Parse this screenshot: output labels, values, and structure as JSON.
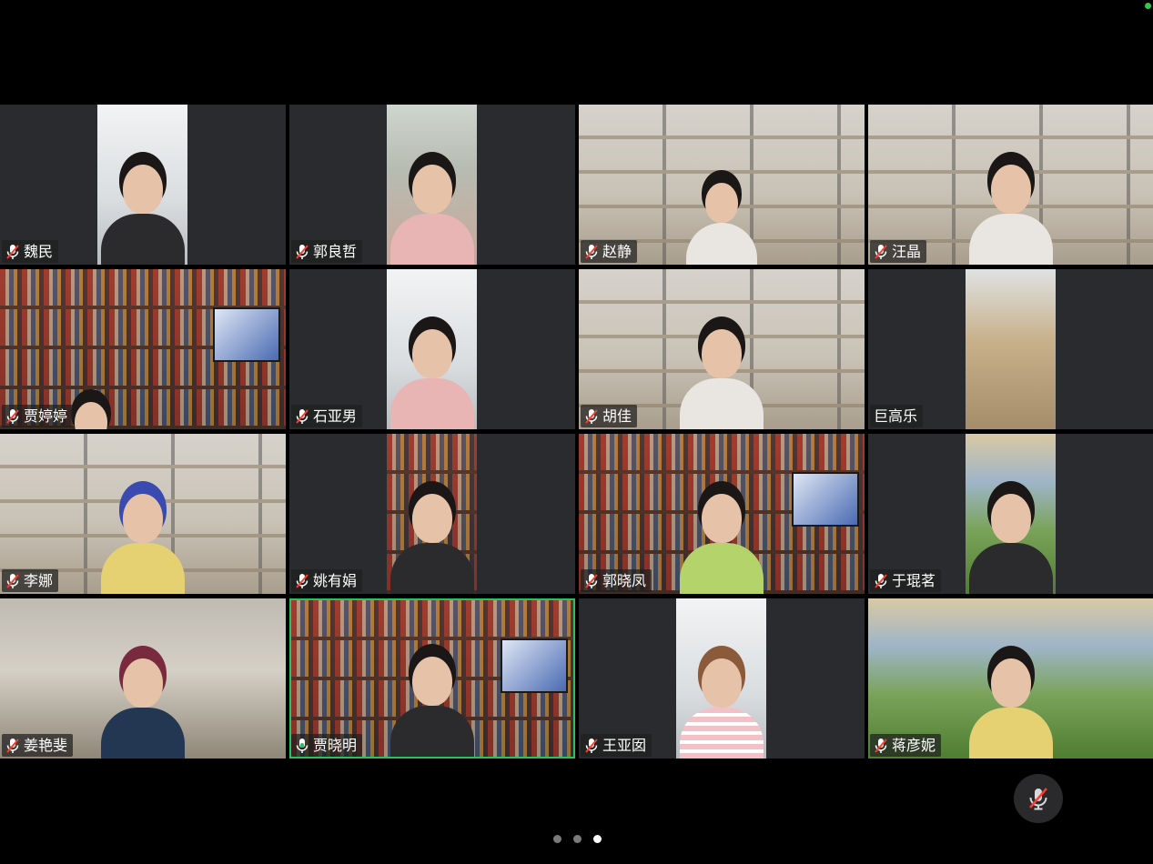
{
  "status": {
    "indicator_color": "#2ecc40"
  },
  "colors": {
    "active_speaker_border": "#22c55e",
    "tile_bg": "#2a2b2e",
    "muted_icon": "#ff3b30"
  },
  "participants": [
    {
      "name": "魏民",
      "muted": true
    },
    {
      "name": "郭良哲",
      "muted": true
    },
    {
      "name": "赵静",
      "muted": true
    },
    {
      "name": "汪晶",
      "muted": true
    },
    {
      "name": "贾婷婷",
      "muted": true
    },
    {
      "name": "石亚男",
      "muted": true
    },
    {
      "name": "胡佳",
      "muted": true
    },
    {
      "name": "巨高乐",
      "muted": false,
      "video_only_label": true
    },
    {
      "name": "李娜",
      "muted": true
    },
    {
      "name": "姚有娟",
      "muted": true
    },
    {
      "name": "郭晓凤",
      "muted": true
    },
    {
      "name": "于琨茗",
      "muted": true
    },
    {
      "name": "姜艳斐",
      "muted": true
    },
    {
      "name": "贾晓明",
      "muted": false,
      "active_speaker": true
    },
    {
      "name": "王亚囡",
      "muted": true
    },
    {
      "name": "蒋彦妮",
      "muted": true
    }
  ],
  "controls": {
    "mic_button_icon": "mic-muted-icon"
  },
  "pager": {
    "page_count": 3,
    "current_page": 3
  }
}
